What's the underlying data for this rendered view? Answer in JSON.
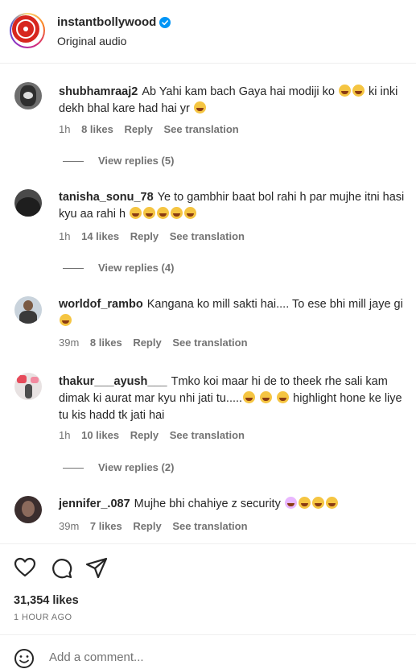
{
  "header": {
    "username": "instantbollywood",
    "subtitle": "Original audio",
    "verified": true
  },
  "comments": [
    {
      "username": "shubhamraaj2",
      "text_parts": [
        "Ab Yahi kam bach Gaya hai modiji ko ",
        " ki inki dekh bhal kare had hai yr "
      ],
      "time": "1h",
      "likes": "8 likes",
      "reply": "Reply",
      "translate": "See translation",
      "view_replies": "View replies (5)"
    },
    {
      "username": "tanisha_sonu_78",
      "text_parts": [
        "Ye to gambhir baat bol rahi h par mujhe itni hasi kyu aa rahi h "
      ],
      "time": "1h",
      "likes": "14 likes",
      "reply": "Reply",
      "translate": "See translation",
      "view_replies": "View replies (4)"
    },
    {
      "username": "worldof_rambo",
      "text_parts": [
        "Kangana ko mill sakti hai.... To ese bhi mill jaye gi"
      ],
      "time": "39m",
      "likes": "8 likes",
      "reply": "Reply",
      "translate": "See translation"
    },
    {
      "username": "thakur___ayush___",
      "text_parts": [
        "Tmko koi maar hi de to theek rhe sali kam dimak ki aurat mar kyu nhi jati tu.....",
        " highlight hone ke liye tu kis hadd tk jati hai"
      ],
      "time": "1h",
      "likes": "10 likes",
      "reply": "Reply",
      "translate": "See translation",
      "view_replies": "View replies (2)"
    },
    {
      "username": "jennifer_.087",
      "text_parts": [
        "Mujhe bhi chahiye z security "
      ],
      "time": "39m",
      "likes": "7 likes",
      "reply": "Reply",
      "translate": "See translation"
    }
  ],
  "actions": {
    "likes": "31,354 likes",
    "time_ago": "1 HOUR AGO"
  },
  "add_comment": {
    "placeholder": "Add a comment..."
  },
  "icons": [
    "heart-icon",
    "comment-icon",
    "share-icon",
    "emoji-icon",
    "verified-badge-icon"
  ],
  "colors": {
    "accent": "#0095f6",
    "text": "#262626",
    "muted": "#737373"
  }
}
